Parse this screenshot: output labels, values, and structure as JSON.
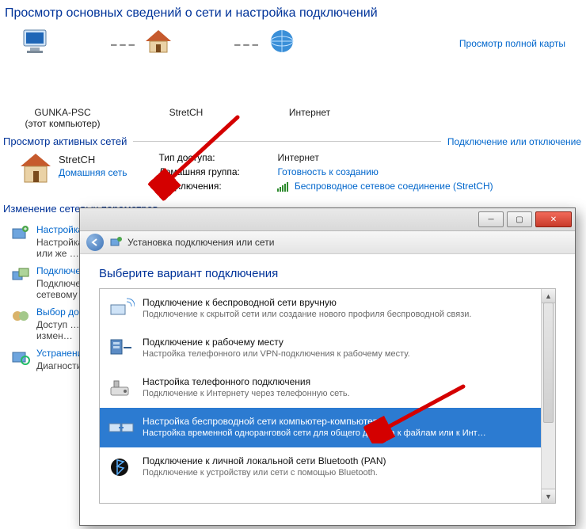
{
  "heading": "Просмотр основных сведений о сети и настройка подключений",
  "map": {
    "this_pc": "GUNKA-PSC",
    "this_pc_sub": "(этот компьютер)",
    "router": "StretCH",
    "internet": "Интернет",
    "view_full": "Просмотр полной карты"
  },
  "active": {
    "title": "Просмотр активных сетей",
    "toggle": "Подключение или отключение",
    "name": "StretCH",
    "type": "Домашняя сеть",
    "labels": {
      "access": "Тип доступа:",
      "homegroup": "Домашняя группа:",
      "connections": "Подключения:"
    },
    "values": {
      "access": "Интернет",
      "homegroup": "Готовность к созданию",
      "connection": "Беспроводное сетевое соединение (StretCH)"
    }
  },
  "change": {
    "title": "Изменение сетевых параметров"
  },
  "tasks": [
    {
      "title": "Настройка нового подключения или сети",
      "desc": "Настройка беспроводного, широкополосного, …",
      "desc2": "или же … "
    },
    {
      "title": "Подключение к сети",
      "desc": "Подключение или повторное подключение к беспроводному,",
      "desc2": "сетевому …"
    },
    {
      "title": "Выбор домашней группы и параметров общего доступа",
      "desc": "Доступ …",
      "desc2": "измен…"
    },
    {
      "title": "Устранение неполадок",
      "desc": "Диагностика …"
    }
  ],
  "wizard": {
    "toolbar_title": "Установка подключения или сети",
    "heading": "Выберите вариант подключения",
    "options": [
      {
        "title": "Подключение к беспроводной сети вручную",
        "desc": "Подключение к скрытой сети или создание нового профиля беспроводной связи."
      },
      {
        "title": "Подключение к рабочему месту",
        "desc": "Настройка телефонного или VPN-подключения к рабочему месту."
      },
      {
        "title": "Настройка телефонного подключения",
        "desc": "Подключение к Интернету через телефонную сеть."
      },
      {
        "title": "Настройка беспроводной сети компьютер-компьютер",
        "desc": "Настройка временной одноранговой сети для общего доступа к файлам или к Инт…",
        "selected": true
      },
      {
        "title": "Подключение к личной локальной сети Bluetooth (PAN)",
        "desc": "Подключение к устройству или сети с помощью Bluetooth."
      }
    ]
  }
}
